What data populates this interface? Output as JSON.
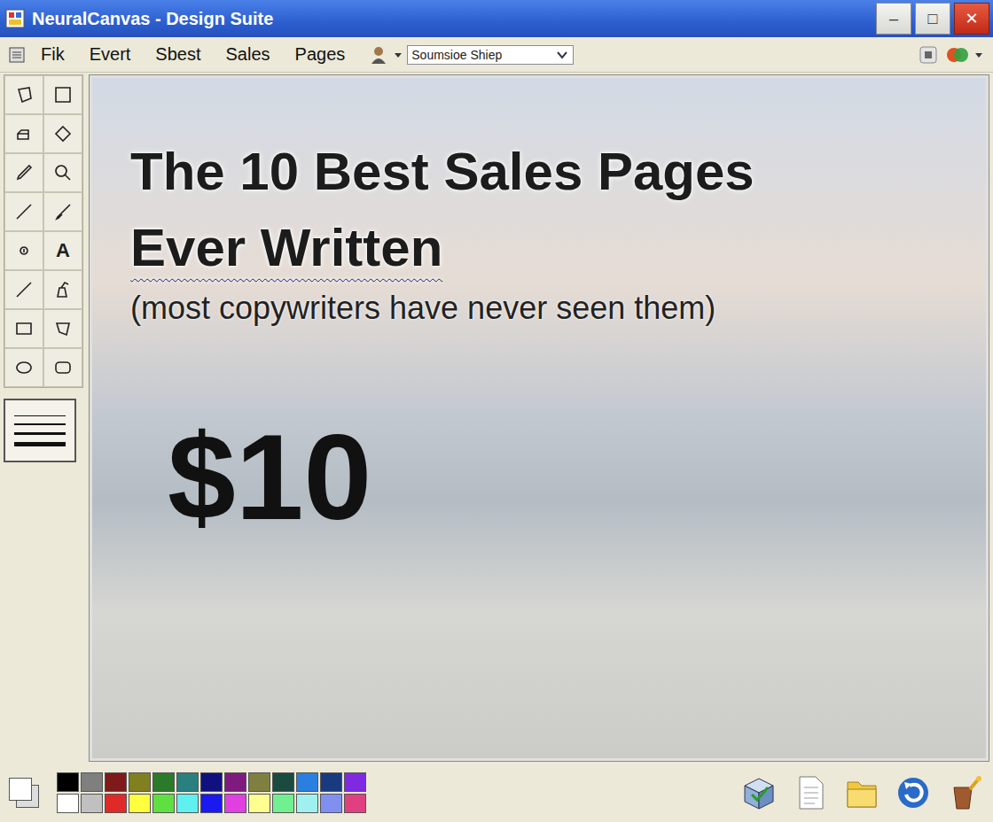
{
  "window": {
    "title": "NeuralCanvas - Design Suite",
    "controls": [
      "–",
      "□",
      "✕"
    ]
  },
  "menu": {
    "items": [
      "Fik",
      "Evert",
      "Sbest",
      "Sales",
      "Pages"
    ],
    "dropdown": {
      "value": "Soumsioe Shiep"
    }
  },
  "tools": [
    {
      "kind": "lasso"
    },
    {
      "kind": "select"
    },
    {
      "kind": "eraser"
    },
    {
      "kind": "fill"
    },
    {
      "kind": "picker"
    },
    {
      "kind": "zoom"
    },
    {
      "kind": "pencil"
    },
    {
      "kind": "brush"
    },
    {
      "kind": "airbrush"
    },
    {
      "kind": "text",
      "label": "A"
    },
    {
      "kind": "line"
    },
    {
      "kind": "spray"
    },
    {
      "kind": "rect"
    },
    {
      "kind": "polygon"
    },
    {
      "kind": "ellipse"
    },
    {
      "kind": "roundrect"
    }
  ],
  "canvas": {
    "headline_lines": [
      "The 10 Best Sales Pages",
      "Ever Written"
    ],
    "subtitle": "(most copywriters have never seen them)",
    "price": "$10"
  },
  "palette": [
    {
      "color": "#000000"
    },
    {
      "color": "#7f7f7f"
    },
    {
      "color": "#7f1a1a"
    },
    {
      "color": "#808020"
    },
    {
      "color": "#2a7a2a"
    },
    {
      "color": "#2a7f7f"
    },
    {
      "color": "#10107f"
    },
    {
      "color": "#7f1a7f"
    },
    {
      "color": "#7f8040"
    },
    {
      "color": "#1a4a40"
    },
    {
      "color": "#2a7fe0"
    },
    {
      "color": "#1a3a80"
    },
    {
      "color": "#7f2ae0"
    },
    {
      "color": "#ffffff"
    },
    {
      "color": "#c0c0c0"
    },
    {
      "color": "#e02a2a"
    },
    {
      "color": "#ffff40"
    },
    {
      "color": "#60e040"
    },
    {
      "color": "#60f0f0"
    },
    {
      "color": "#1a1af0"
    },
    {
      "color": "#e040e0"
    },
    {
      "color": "#ffff90"
    },
    {
      "color": "#70f090"
    },
    {
      "color": "#a0f0f0"
    },
    {
      "color": "#8090f0"
    },
    {
      "color": "#e04080"
    }
  ]
}
